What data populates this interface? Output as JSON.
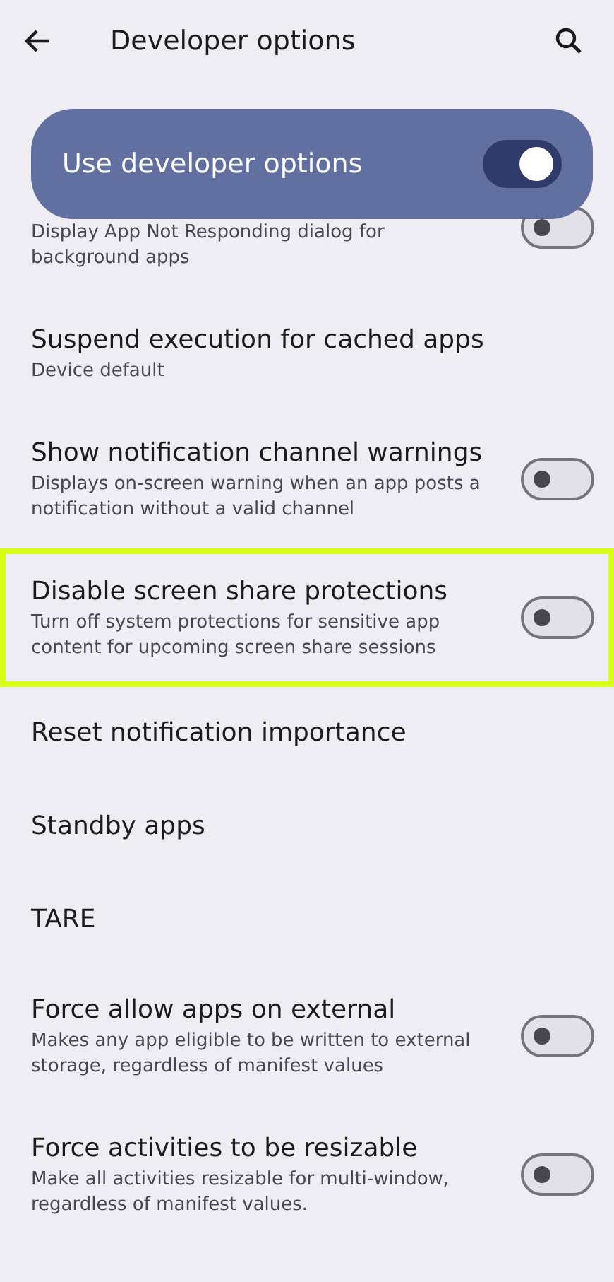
{
  "app_bar": {
    "title": "Developer options"
  },
  "banner": {
    "label": "Use developer options",
    "on": true
  },
  "settings": [
    {
      "summary": "Display App Not Responding dialog for background apps",
      "kind": "toggle",
      "on": false,
      "highlighted": false
    },
    {
      "title": "Suspend execution for cached apps",
      "summary": "Device default",
      "kind": "plain",
      "highlighted": false
    },
    {
      "title": "Show notification channel warnings",
      "summary": "Displays on-screen warning when an app posts a notification without a valid channel",
      "kind": "toggle",
      "on": false,
      "highlighted": false
    },
    {
      "title": "Disable screen share protections",
      "summary": "Turn off system protections for sensitive app content for upcoming screen share sessions",
      "kind": "toggle",
      "on": false,
      "highlighted": true
    },
    {
      "title": "Reset notification importance",
      "kind": "plain",
      "highlighted": false
    },
    {
      "title": "Standby apps",
      "kind": "plain",
      "highlighted": false
    },
    {
      "title": "TARE",
      "kind": "plain",
      "highlighted": false
    },
    {
      "title": "Force allow apps on external",
      "summary": "Makes any app eligible to be written to external storage, regardless of manifest values",
      "kind": "toggle",
      "on": false,
      "highlighted": false
    },
    {
      "title": "Force activities to be resizable",
      "summary": "Make all activities resizable for multi-window, regardless of manifest values.",
      "kind": "toggle",
      "on": false,
      "highlighted": false
    }
  ]
}
